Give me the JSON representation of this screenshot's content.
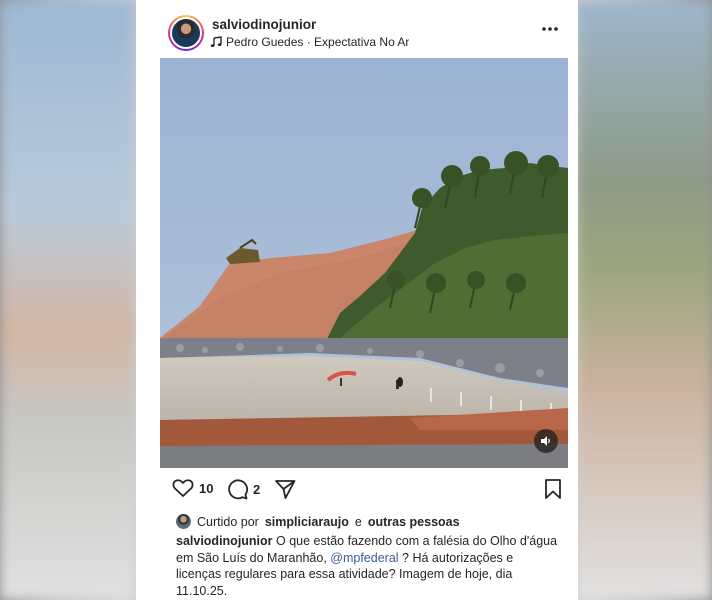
{
  "post": {
    "username": "salviodinojunior",
    "audio": "Pedro Guedes · Expectativa No Ar",
    "likes_count": "10",
    "comments_count": "2",
    "liked_by": {
      "prefix": "Curtido por",
      "user": "simpliciaraujo",
      "joiner": "e",
      "others": "outras pessoas"
    },
    "caption": {
      "author": "salviodinojunior",
      "text_before": "O que estão fazendo com a falésia do Olho d'água em São Luís do Maranhão,",
      "mention": "@mpfederal",
      "text_after": "? Há autorizações e licenças regulares para essa atividade? Imagem de hoje, dia 11.10.25."
    }
  },
  "icons": {
    "music": "music-note-icon",
    "more": "more-options-icon",
    "like": "heart-icon",
    "comment": "comment-bubble-icon",
    "share": "paper-plane-icon",
    "save": "bookmark-icon",
    "sound": "speaker-icon"
  }
}
